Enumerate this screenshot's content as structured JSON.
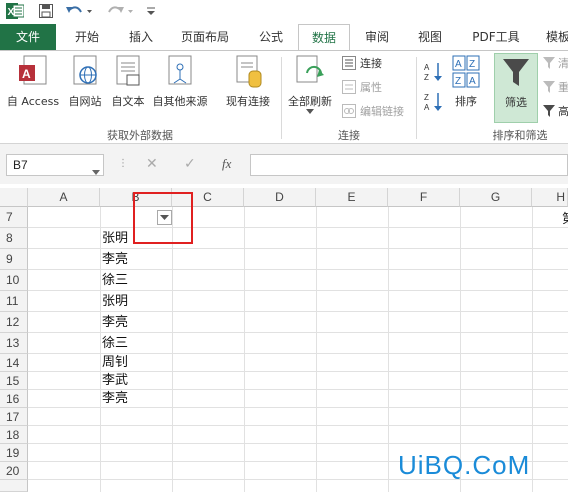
{
  "app": {
    "icon": "excel-icon",
    "accent_color": "#217346"
  },
  "quick_access": {
    "save_icon": "save-icon",
    "undo_icon": "undo-icon",
    "redo_icon": "redo-icon",
    "customize_icon": "customize-icon"
  },
  "tabs": [
    {
      "label": "文件"
    },
    {
      "label": "开始"
    },
    {
      "label": "插入"
    },
    {
      "label": "页面布局"
    },
    {
      "label": "公式"
    },
    {
      "label": "数据"
    },
    {
      "label": "审阅"
    },
    {
      "label": "视图"
    },
    {
      "label": "PDF工具"
    },
    {
      "label": "模板"
    }
  ],
  "ribbon": {
    "get_external": {
      "access": "自 Access",
      "web": "自网站",
      "text": "自文本",
      "other": "自其他来源",
      "existing": "现有连接",
      "label": "获取外部数据"
    },
    "connections": {
      "refresh_all": "全部刷新",
      "connections": "连接",
      "properties": "属性",
      "edit_links": "编辑链接",
      "label": "连接"
    },
    "sort_filter": {
      "sort": "排序",
      "filter": "筛选",
      "clear": "清",
      "reapply": "重",
      "advanced": "高",
      "label": "排序和筛选"
    }
  },
  "formula_bar": {
    "name_box": "B7",
    "fx": "fx",
    "cancel": "✕",
    "enter": "✓",
    "formula": ""
  },
  "columns": [
    "A",
    "B",
    "C",
    "D",
    "E",
    "F",
    "G",
    "H"
  ],
  "rows": [
    "7",
    "8",
    "9",
    "10",
    "11",
    "12",
    "13",
    "14",
    "15",
    "16",
    "17",
    "18",
    "19",
    "20"
  ],
  "column_b_values": [
    "张明",
    "李亮",
    "徐三",
    "张明",
    "李亮",
    "徐三",
    "周钊",
    "李武",
    "李亮"
  ],
  "h7_partial": "第",
  "watermark": "UiBQ.CoM"
}
